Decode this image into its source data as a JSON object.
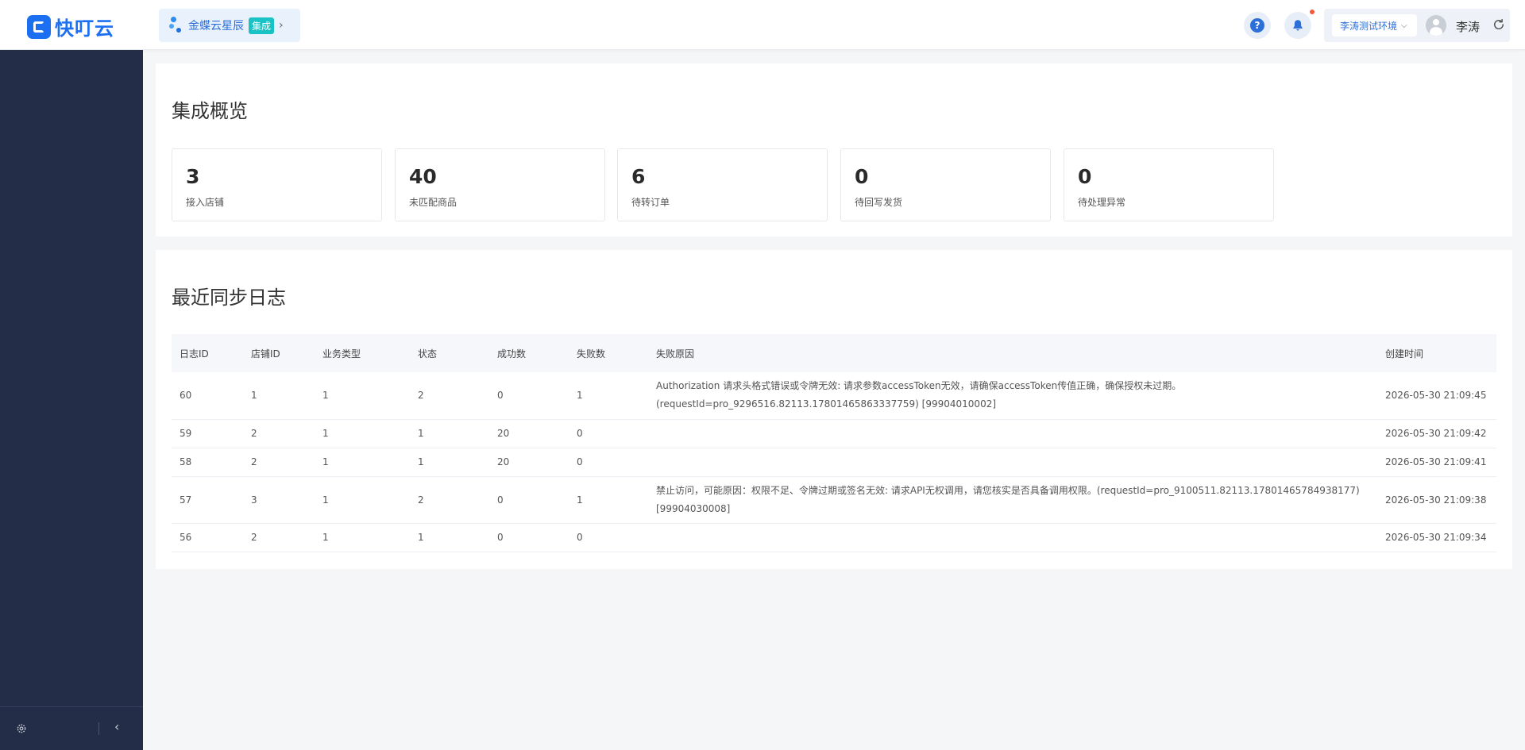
{
  "brand": {
    "name": "快叮云",
    "color": "#1d6ff2"
  },
  "app_switch": {
    "name": "金蝶云星辰",
    "tag": "集成"
  },
  "header": {
    "environment": "李涛测试环境",
    "user_name": "李涛"
  },
  "overview": {
    "title": "集成概览",
    "stats": [
      {
        "value": "3",
        "label": "接入店铺"
      },
      {
        "value": "40",
        "label": "未匹配商品"
      },
      {
        "value": "6",
        "label": "待转订单"
      },
      {
        "value": "0",
        "label": "待回写发货"
      },
      {
        "value": "0",
        "label": "待处理异常"
      }
    ]
  },
  "logs": {
    "title": "最近同步日志",
    "columns": [
      "日志ID",
      "店铺ID",
      "业务类型",
      "状态",
      "成功数",
      "失败数",
      "失败原因",
      "创建时间"
    ],
    "rows": [
      {
        "id": "60",
        "shop_id": "1",
        "biz_type": "1",
        "status": "2",
        "success": "0",
        "failed": "1",
        "reason": "Authorization 请求头格式错误或令牌无效: 请求参数accessToken无效，请确保accessToken传值正确，确保授权未过期。(requestId=pro_9296516.82113.17801465863337759) [99904010002]",
        "created": "2026-05-30 21:09:45"
      },
      {
        "id": "59",
        "shop_id": "2",
        "biz_type": "1",
        "status": "1",
        "success": "20",
        "failed": "0",
        "reason": "",
        "created": "2026-05-30 21:09:42"
      },
      {
        "id": "58",
        "shop_id": "2",
        "biz_type": "1",
        "status": "1",
        "success": "20",
        "failed": "0",
        "reason": "",
        "created": "2026-05-30 21:09:41"
      },
      {
        "id": "57",
        "shop_id": "3",
        "biz_type": "1",
        "status": "2",
        "success": "0",
        "failed": "1",
        "reason": "禁止访问，可能原因：权限不足、令牌过期或签名无效: 请求API无权调用，请您核实是否具备调用权限。(requestId=pro_9100511.82113.17801465784938177) [99904030008]",
        "created": "2026-05-30 21:09:38"
      },
      {
        "id": "56",
        "shop_id": "2",
        "biz_type": "1",
        "status": "1",
        "success": "0",
        "failed": "0",
        "reason": "",
        "created": "2026-05-30 21:09:34"
      }
    ]
  },
  "icons": {
    "help": "question-icon",
    "notifications": "bell-icon",
    "refresh": "refresh-icon",
    "settings": "settings-icon",
    "collapse": "chevron-left-icon"
  },
  "colors": {
    "sidebar": "#232d47",
    "accent": "#2d6fd8",
    "tag": "#19c2c4",
    "notify_dot": "#f55a3c"
  }
}
